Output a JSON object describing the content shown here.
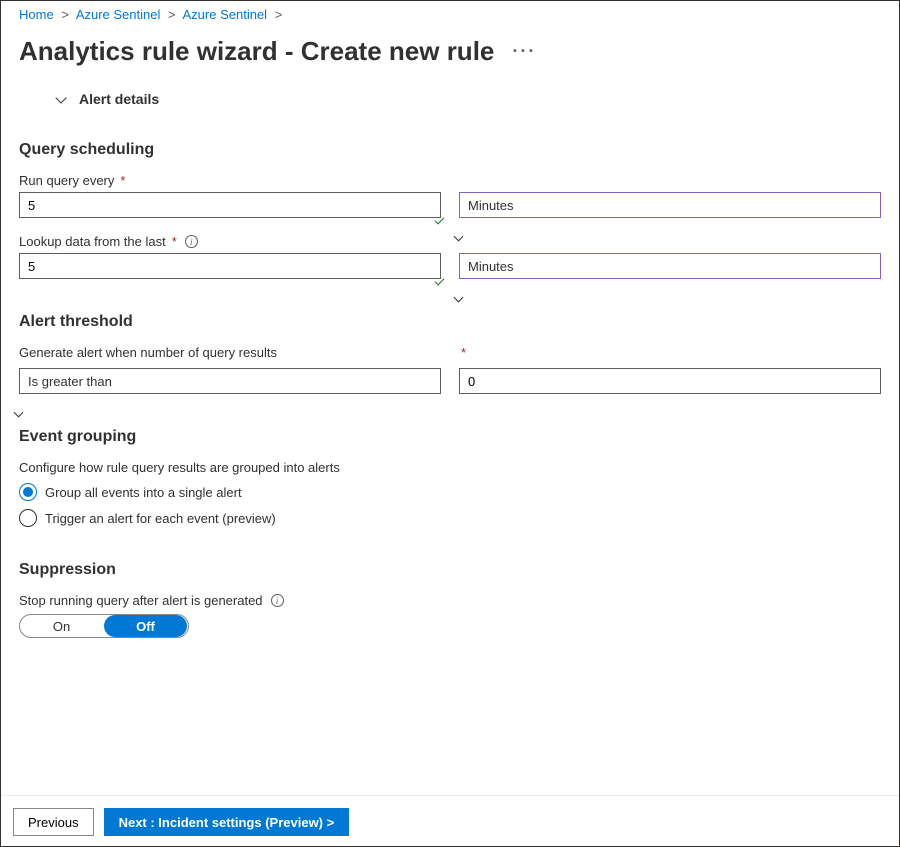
{
  "breadcrumb": {
    "items": [
      "Home",
      "Azure Sentinel",
      "Azure Sentinel"
    ]
  },
  "page_title": "Analytics rule wizard - Create new rule",
  "sections": {
    "alert_details": {
      "label": "Alert details"
    },
    "query_scheduling": {
      "title": "Query scheduling",
      "run_every_label": "Run query every",
      "run_every_value": "5",
      "run_every_unit": "Minutes",
      "lookup_label": "Lookup data from the last",
      "lookup_value": "5",
      "lookup_unit": "Minutes"
    },
    "alert_threshold": {
      "title": "Alert threshold",
      "label": "Generate alert when number of query results",
      "operator": "Is greater than",
      "value": "0"
    },
    "event_grouping": {
      "title": "Event grouping",
      "description": "Configure how rule query results are grouped into alerts",
      "option1": "Group all events into a single alert",
      "option2": "Trigger an alert for each event (preview)"
    },
    "suppression": {
      "title": "Suppression",
      "label": "Stop running query after alert is generated",
      "on": "On",
      "off": "Off"
    }
  },
  "footer": {
    "prev": "Previous",
    "next": "Next : Incident settings (Preview) >"
  }
}
